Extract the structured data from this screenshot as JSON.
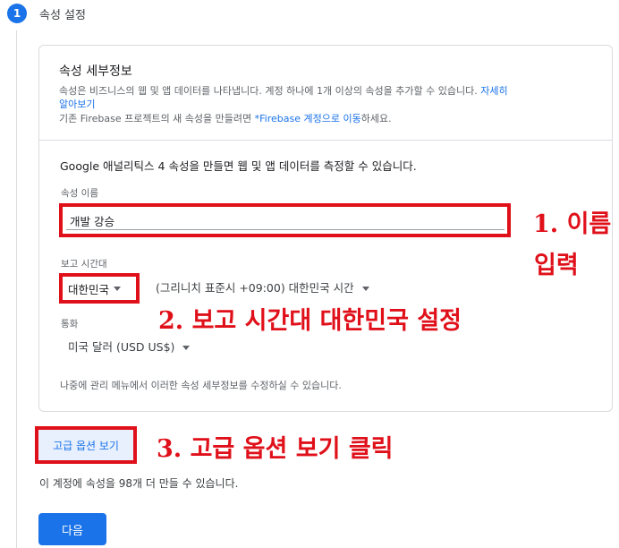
{
  "step": {
    "number": "1",
    "title": "속성 설정"
  },
  "details": {
    "title": "속성 세부정보",
    "desc_line1": "속성은 비즈니스의 웹 및 앱 데이터를 나타냅니다. 계정 하나에 1개 이상의 속성을 추가할 수 있습니다.",
    "desc_link": "자세히",
    "desc_link_cont": "알아보기",
    "firebase_prefix": "기존 Firebase 프로젝트의 새 속성을 만들려면 ",
    "firebase_link": "*Firebase 계정으로 이동",
    "firebase_suffix": "하세요."
  },
  "form": {
    "intro": "Google 애널리틱스 4 속성을 만들면 웹 및 앱 데이터를 측정할 수 있습니다.",
    "name_label": "속성 이름",
    "name_value": "개발 강승",
    "timezone_label": "보고 시간대",
    "timezone_country": "대한민국",
    "timezone_detail": "(그리니치 표준시 +09:00) 대한민국 시간",
    "currency_label": "통화",
    "currency_value": "미국 달러 (USD US$)",
    "footnote": "나중에 관리 메뉴에서 이러한 속성 세부정보를 수정하실 수 있습니다."
  },
  "advanced_button": "고급 옵션 보기",
  "remaining_text": "이 계정에 속성을 98개 더 만들 수 있습니다.",
  "next_button": "다음",
  "annotations": {
    "a1_line1": "1. 이름",
    "a1_line2": "입력",
    "a2": "2. 보고 시간대 대한민국 설정",
    "a3": "3. 고급 옵션 보기 클릭"
  },
  "colors": {
    "accent": "#1a73e8",
    "annotation": "#e0101a"
  }
}
